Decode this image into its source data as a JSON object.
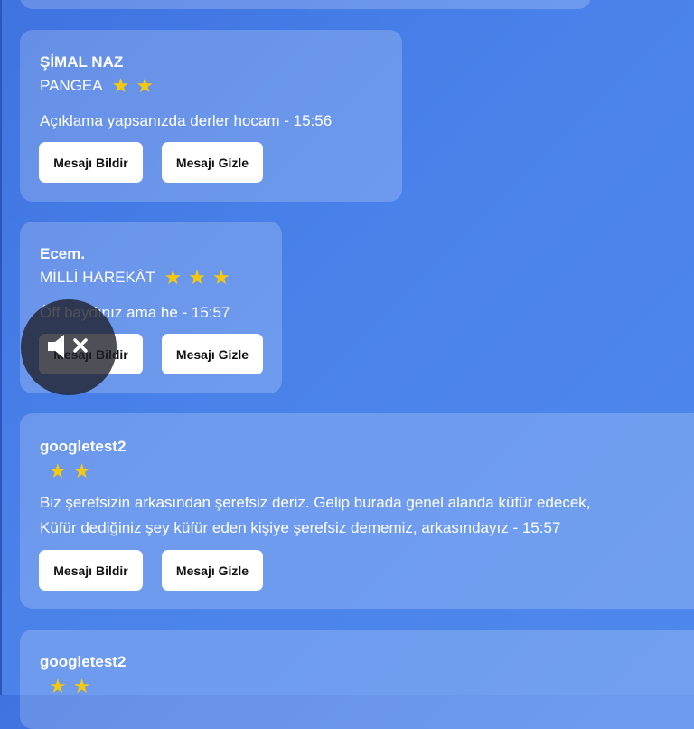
{
  "messages": [
    {
      "username": "ŞİMAL NAZ",
      "group": "PANGEA",
      "stars": 2,
      "text_lines": [
        "Açıklama yapsanızda derler hocam - 15:56"
      ],
      "report_label": "Mesajı Bildir",
      "hide_label": "Mesajı Gizle"
    },
    {
      "username": "Ecem.",
      "group": "MİLLİ HAREKÂT",
      "stars": 3,
      "text_lines": [
        "Öff baydınız ama he - 15:57"
      ],
      "report_label": "Mesajı Bildir",
      "hide_label": "Mesajı Gizle"
    },
    {
      "username": "googletest2",
      "group": "",
      "stars": 2,
      "text_lines": [
        "Biz şerefsizin arkasından şerefsiz deriz. Gelip burada genel alanda küfür edecek,",
        "Küfür dediğiniz şey küfür eden kişiye şerefsiz dememiz, arkasındayız - 15:57"
      ],
      "report_label": "Mesajı Bildir",
      "hide_label": "Mesajı Gizle"
    },
    {
      "username": "googletest2",
      "group": "",
      "stars": 2
    }
  ],
  "colors": {
    "background": "#4a82ea",
    "star": "#f6c90e",
    "card": "rgba(255,255,255,0.20)"
  },
  "icons": {
    "stars": "star-icon",
    "mute_overlay": "muted-speaker-icon"
  }
}
